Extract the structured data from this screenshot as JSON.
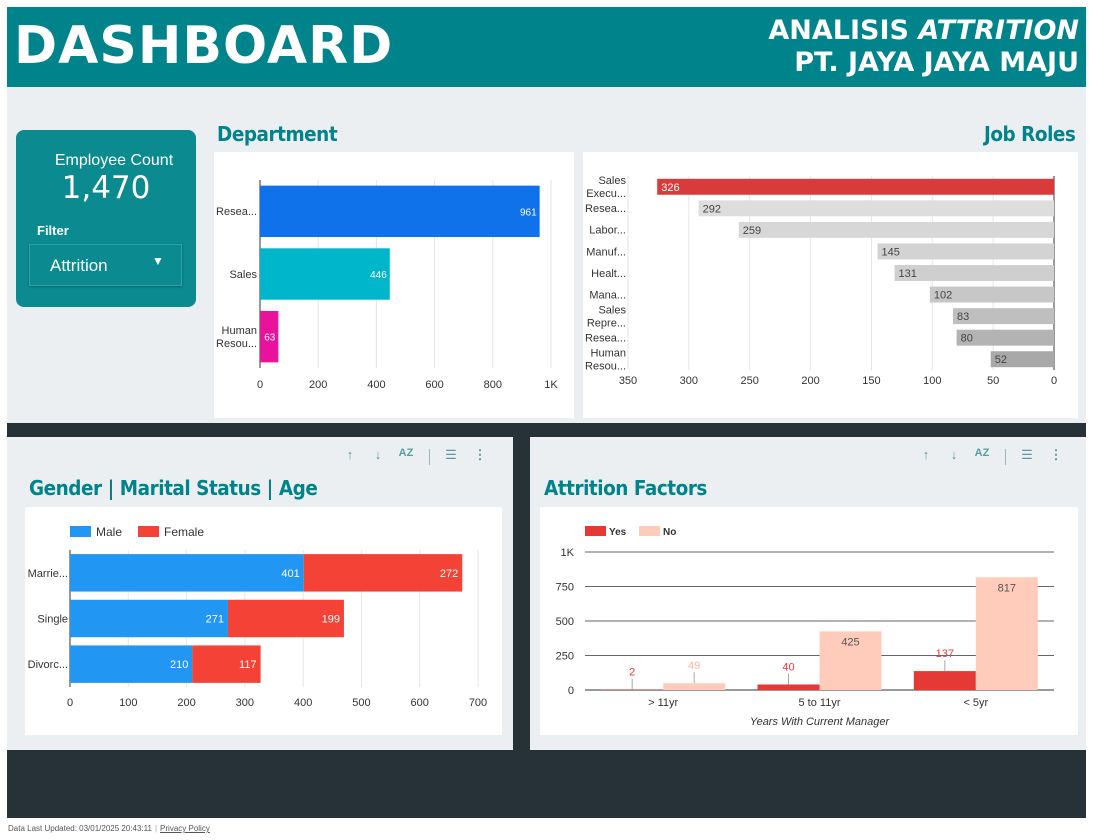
{
  "header": {
    "title": "DASHBOARD",
    "subtitle_line1_prefix": "ANALISIS ",
    "subtitle_line1_italic": "ATTRITION",
    "subtitle_line2": "PT. JAYA JAYA MAJU",
    "background": "#00838a"
  },
  "kpi": {
    "label": "Employee Count",
    "value": "1,470"
  },
  "filter": {
    "label": "Filter",
    "selected": "Attrition",
    "caret_icon": "caret-down-icon"
  },
  "colors": {
    "accent": "#00838a",
    "dept_research": "#0f72ea",
    "dept_sales": "#00b6cb",
    "dept_hr": "#e8139a",
    "job_highlight": "#d93a3a",
    "male": "#2196f3",
    "female": "#f44336",
    "yes": "#e53935",
    "no": "#ffccbc"
  },
  "toolbar_icons": [
    "sort-ascending-icon",
    "sort-descending-icon",
    "sort-az-icon",
    "filter-icon",
    "more-options-icon"
  ],
  "chart_data": [
    {
      "id": "department",
      "type": "bar",
      "orientation": "horizontal",
      "title": "Department",
      "categories": [
        "Resea...",
        "Sales",
        "Human Resou..."
      ],
      "values": [
        961,
        446,
        63
      ],
      "data_labels": [
        "961",
        "446",
        "63"
      ],
      "xlim": [
        0,
        1000
      ],
      "xticks": [
        "0",
        "200",
        "400",
        "600",
        "800",
        "1K"
      ],
      "grid": true
    },
    {
      "id": "job_roles",
      "type": "bar",
      "orientation": "horizontal",
      "x_reversed": true,
      "title": "Job Roles",
      "categories": [
        "Sales Execu...",
        "Resea...",
        "Labor...",
        "Manuf...",
        "Healt...",
        "Mana...",
        "Sales Repre...",
        "Resea...",
        "Human Resou..."
      ],
      "values": [
        326,
        292,
        259,
        145,
        131,
        102,
        83,
        80,
        52
      ],
      "data_labels": [
        "326",
        "292",
        "259",
        "145",
        "131",
        "102",
        "83",
        "80",
        "52"
      ],
      "xlim": [
        0,
        350
      ],
      "xticks": [
        "350",
        "300",
        "250",
        "200",
        "150",
        "100",
        "50",
        "0"
      ],
      "grid": true
    },
    {
      "id": "gender_marital",
      "type": "bar",
      "orientation": "horizontal",
      "stacked": true,
      "title": "Gender | Marital Status | Age",
      "categories": [
        "Marrie...",
        "Single",
        "Divorc..."
      ],
      "series": [
        {
          "name": "Male",
          "values": [
            401,
            271,
            210
          ]
        },
        {
          "name": "Female",
          "values": [
            272,
            199,
            117
          ]
        }
      ],
      "legend": "top-left",
      "xlim": [
        0,
        700
      ],
      "xticks": [
        "0",
        "100",
        "200",
        "300",
        "400",
        "500",
        "600",
        "700"
      ],
      "grid": true
    },
    {
      "id": "attrition_factors",
      "type": "bar",
      "orientation": "vertical",
      "title": "Attrition Factors",
      "categories": [
        "> 11yr",
        "5 to 11yr",
        "< 5yr"
      ],
      "series": [
        {
          "name": "Yes",
          "values": [
            2,
            40,
            137
          ]
        },
        {
          "name": "No",
          "values": [
            49,
            425,
            817
          ]
        }
      ],
      "xlabel": "Years With Current Manager",
      "legend": "top-left",
      "ylim": [
        0,
        1000
      ],
      "yticks": [
        "0",
        "250",
        "500",
        "750",
        "1K"
      ],
      "grid": true
    }
  ],
  "footer": {
    "updated": "Data Last Updated: 03/01/2025 20:43:11",
    "privacy": "Privacy Policy"
  }
}
